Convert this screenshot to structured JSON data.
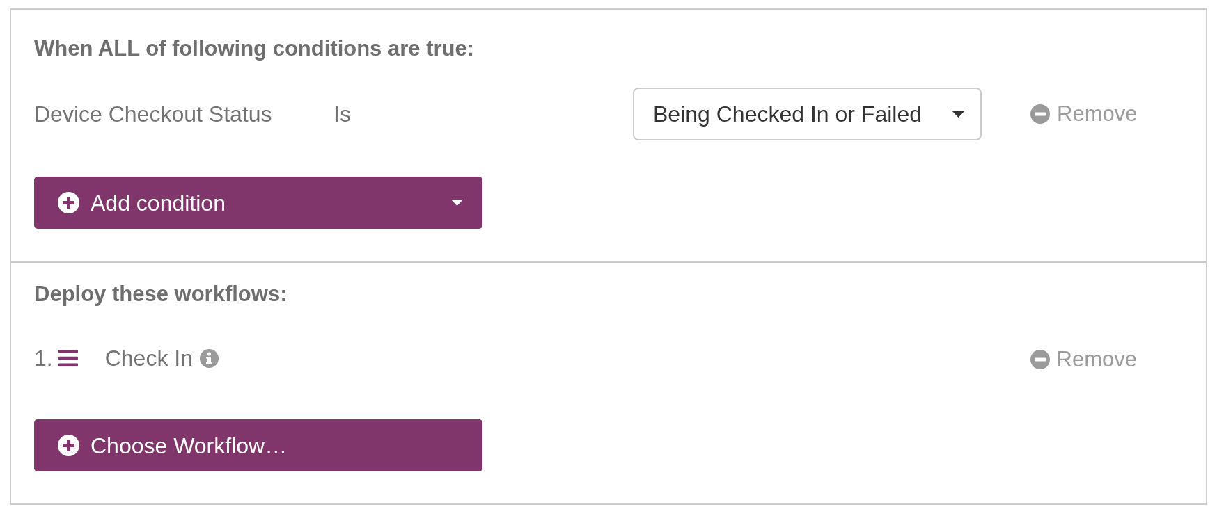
{
  "conditions_section": {
    "heading": "When ALL of following conditions are true:",
    "conditions": [
      {
        "field": "Device Checkout Status",
        "operator": "Is",
        "value": "Being Checked In or Failed",
        "remove_label": "Remove"
      }
    ],
    "add_button": {
      "label": "Add condition"
    }
  },
  "workflows_section": {
    "heading": "Deploy these workflows:",
    "workflows": [
      {
        "number": "1.",
        "name": "Check In",
        "remove_label": "Remove"
      }
    ],
    "choose_button": {
      "label": "Choose Workflow…"
    }
  }
}
